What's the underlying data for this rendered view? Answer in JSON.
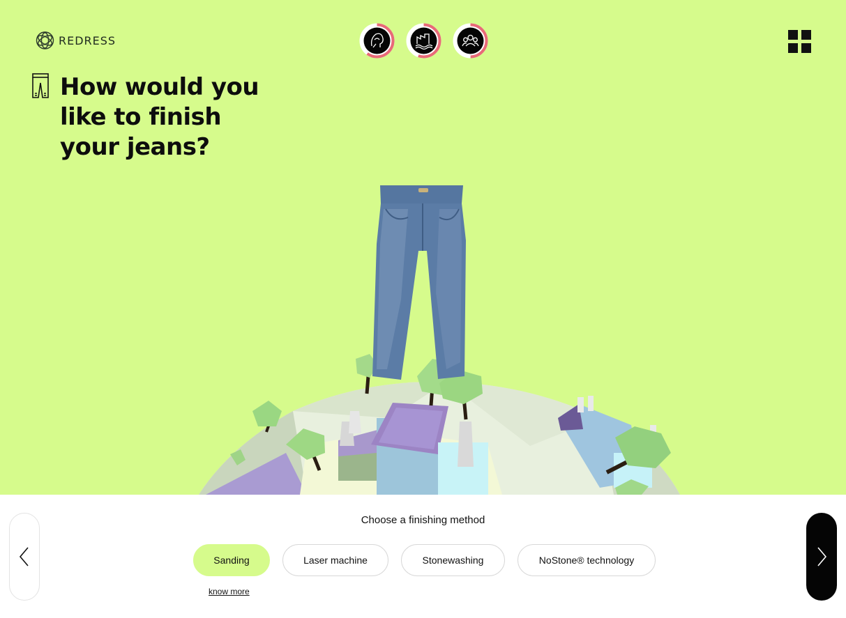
{
  "brand": {
    "name": "REDRESS",
    "logo_icon": "knot-logo-icon"
  },
  "progress_steps": [
    {
      "icon": "brain-leaf-icon",
      "progress": 0.6,
      "label": "Environment"
    },
    {
      "icon": "factory-water-icon",
      "progress": 0.55,
      "label": "Water"
    },
    {
      "icon": "people-group-icon",
      "progress": 0.5,
      "label": "Social"
    }
  ],
  "menu_icon": "grid-menu-icon",
  "question": {
    "icon": "jeans-outline-icon",
    "text": "How would you like to finish your jeans?"
  },
  "panel": {
    "prompt": "Choose a finishing method",
    "options": [
      "Sanding",
      "Laser machine",
      "Stonewashing",
      "NoStone® technology"
    ],
    "selected": "Sanding",
    "know_more": "know more",
    "prev_icon": "chevron-left-icon",
    "next_icon": "chevron-right-icon"
  },
  "colors": {
    "background": "#d6fb8c",
    "accent_ring": "#e86a78",
    "dark": "#050505"
  }
}
